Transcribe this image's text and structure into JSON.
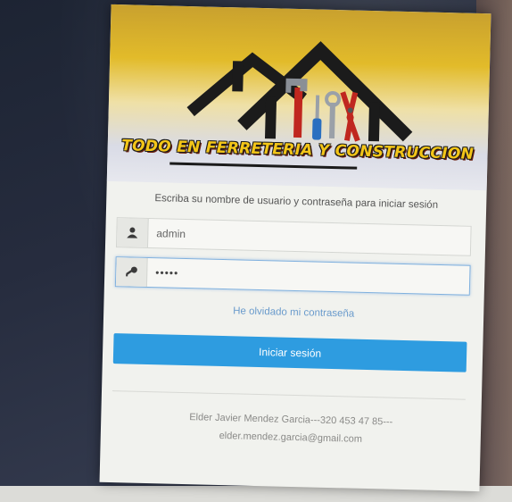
{
  "brand": {
    "name": "TODO EN FERRETERIA Y CONSTRUCCION",
    "colors": {
      "banner_gold": "#e2bb2a",
      "text_yellow": "#f4c518",
      "accent_blue": "#2e9ce0"
    }
  },
  "login": {
    "instructions": "Escriba su nombre de usuario y contraseña para iniciar sesión",
    "username": {
      "value": "admin",
      "icon": "user-icon"
    },
    "password": {
      "value": "•••••",
      "icon": "key-icon"
    },
    "forgot_link": "He olvidado mi contraseña",
    "submit_label": "Iniciar sesión"
  },
  "footer": {
    "contact_line1": "Elder Javier Mendez Garcia---320 453 47 85---",
    "contact_line2": "elder.mendez.garcia@gmail.com"
  }
}
